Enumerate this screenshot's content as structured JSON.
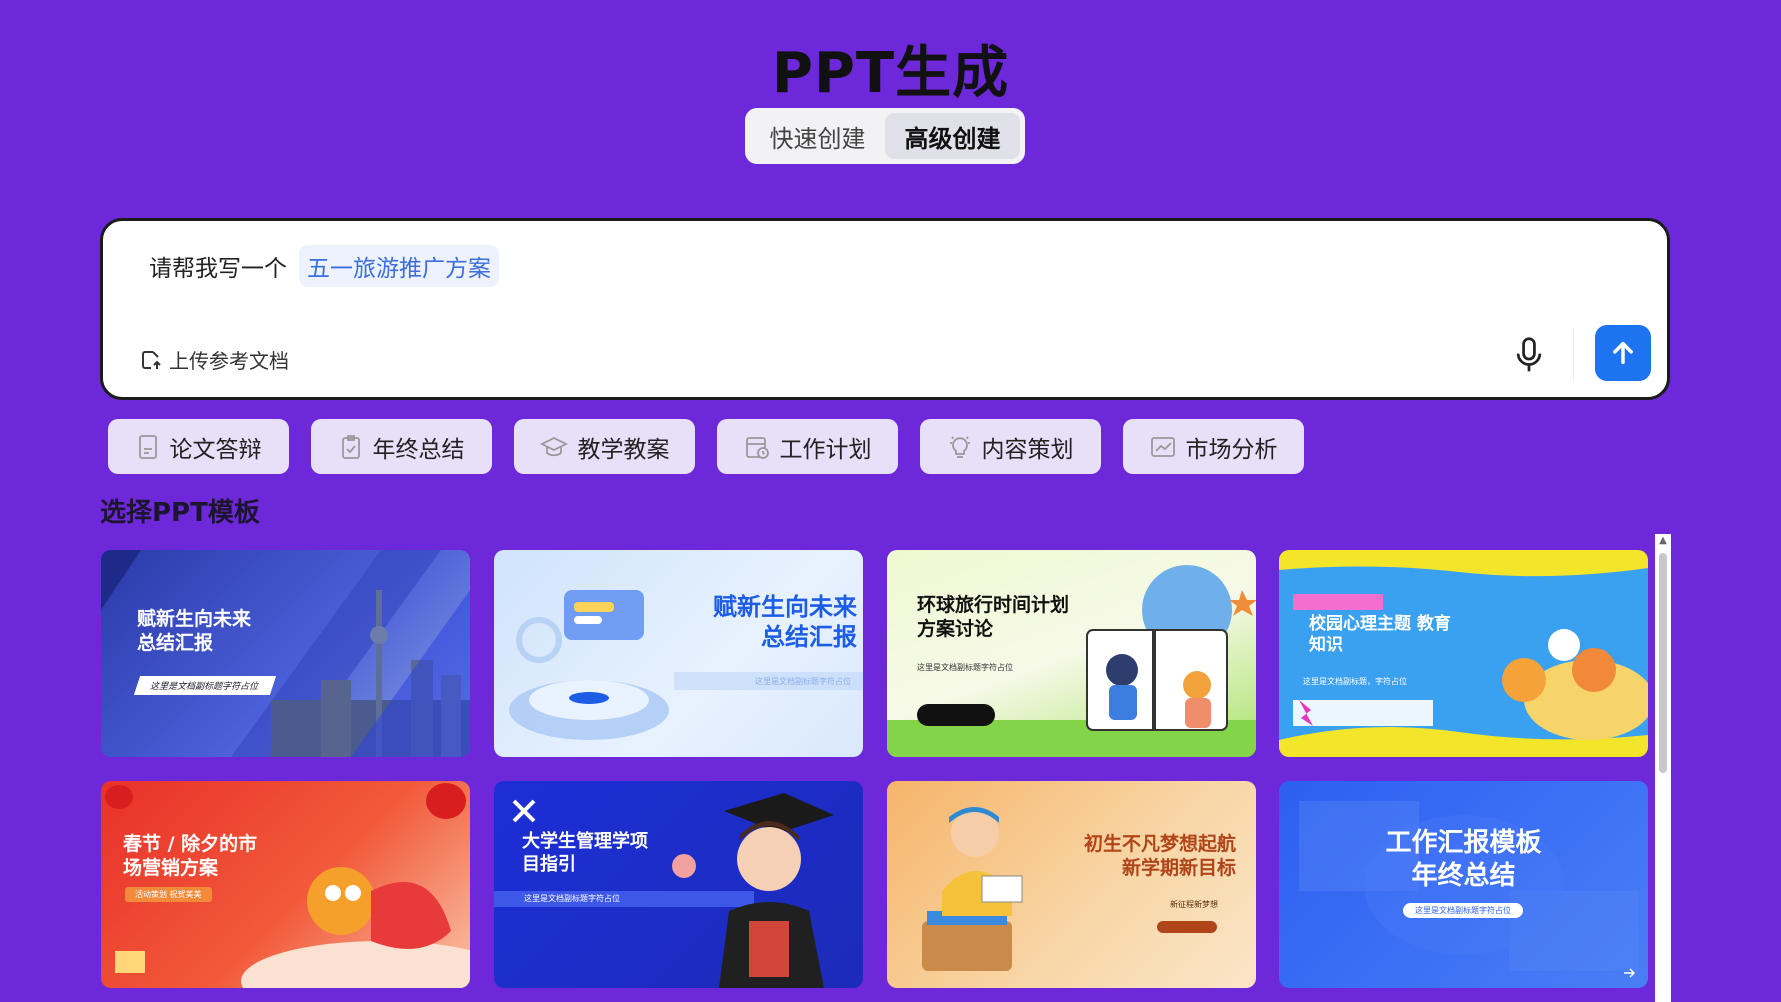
{
  "header": {
    "title": "PPT生成"
  },
  "mode_tabs": [
    {
      "label": "快速创建",
      "active": false
    },
    {
      "label": "高级创建",
      "active": true
    }
  ],
  "prompt": {
    "prefix": "请帮我写一个",
    "chip": "五一旅游推广方案",
    "upload_label": "上传参考文档"
  },
  "quick_actions": [
    {
      "label": "论文答辩",
      "icon": "document-icon"
    },
    {
      "label": "年终总结",
      "icon": "clipboard-check-icon"
    },
    {
      "label": "教学教案",
      "icon": "graduation-cap-icon"
    },
    {
      "label": "工作计划",
      "icon": "calendar-clock-icon"
    },
    {
      "label": "内容策划",
      "icon": "lightbulb-icon"
    },
    {
      "label": "市场分析",
      "icon": "chart-icon"
    }
  ],
  "section_title": "选择PPT模板",
  "templates": [
    {
      "title": "赋新生向未来\n总结汇报",
      "subtitle": "这里是文档副标题字符占位"
    },
    {
      "title": "赋新生向未来\n总结汇报",
      "subtitle": "这里是文档副标题字符占位"
    },
    {
      "title": "环球旅行时间计划\n方案讨论",
      "subtitle": "这里是文档副标题字符占位"
    },
    {
      "title": "校园心理主题 教育\n知识",
      "subtitle": "这里是文档副标题，字符占位"
    },
    {
      "title": "春节 / 除夕的市\n场营销方案",
      "subtitle": "活动策划 祝贺美美"
    },
    {
      "title": "大学生管理学项\n目指引",
      "subtitle": "这里是文档副标题字符占位"
    },
    {
      "title": "初生不凡梦想起航\n新学期新目标",
      "subtitle": "新征程新梦想"
    },
    {
      "title": "工作汇报模板\n年终总结",
      "subtitle": "这里是文档副标题字符占位"
    }
  ],
  "colors": {
    "background": "#6c28d9",
    "accent": "#1e74f0",
    "chip_text": "#3b6fe0"
  }
}
